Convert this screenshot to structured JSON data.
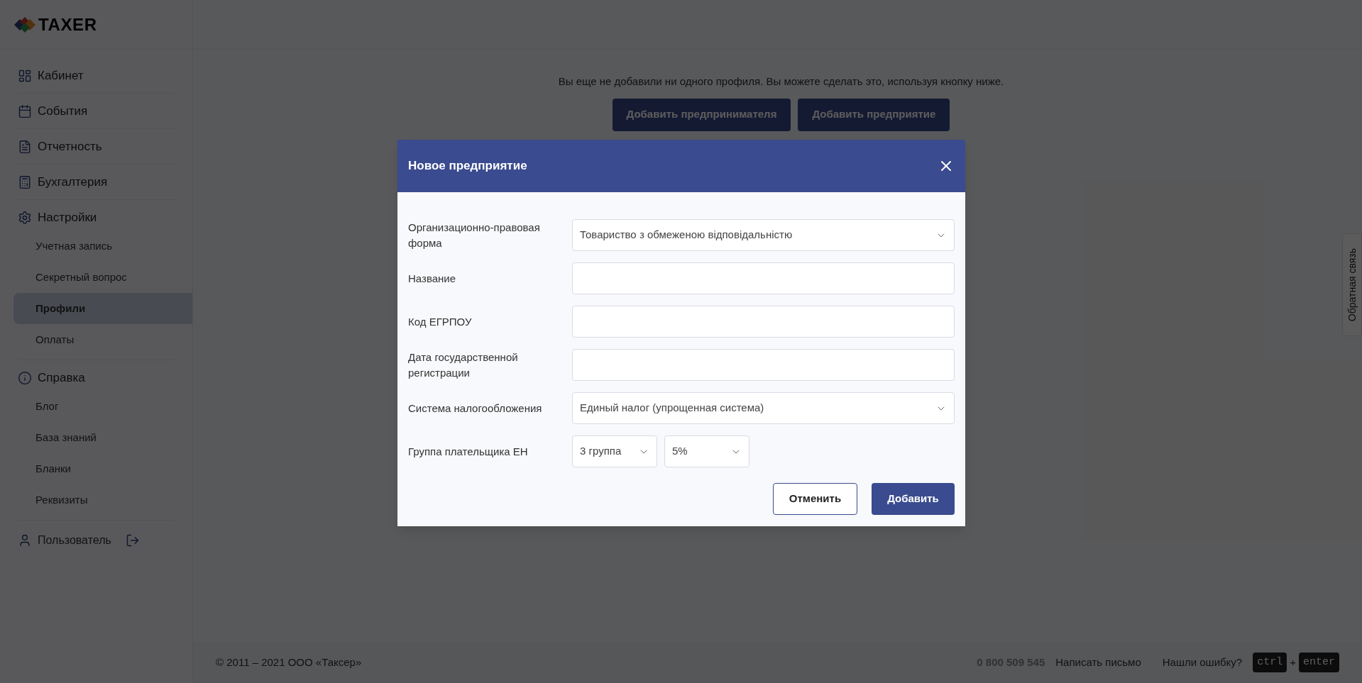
{
  "logo": {
    "text": "TAXER"
  },
  "sidebar": {
    "sections": [
      {
        "label": "Кабинет"
      },
      {
        "label": "События"
      },
      {
        "label": "Отчетность"
      },
      {
        "label": "Бухгалтерия"
      },
      {
        "label": "Настройки",
        "children": [
          {
            "label": "Учетная запись",
            "selected": false
          },
          {
            "label": "Секретный вопрос",
            "selected": false
          },
          {
            "label": "Профили",
            "selected": true
          },
          {
            "label": "Оплаты",
            "selected": false
          }
        ]
      },
      {
        "label": "Справка",
        "children": [
          {
            "label": "Блог",
            "selected": false
          },
          {
            "label": "База знаний",
            "selected": false
          },
          {
            "label": "Бланки",
            "selected": false
          },
          {
            "label": "Реквизиты",
            "selected": false
          }
        ]
      }
    ],
    "user": {
      "label": "Пользователь"
    }
  },
  "main": {
    "message": "Вы еще не добавили ни одного профиля. Вы можете сделать это, используя кнопку ниже.",
    "buttons": [
      "Добавить предпринимателя",
      "Добавить предприятие"
    ]
  },
  "dialog": {
    "title": "Новое предприятие",
    "fields": [
      {
        "kind": "select",
        "label": "Организационно-правовая форма",
        "value": "Товариство з обмеженою відповідальністю"
      },
      {
        "kind": "input",
        "label": "Название"
      },
      {
        "kind": "input",
        "label": "Код ЕГРПОУ"
      },
      {
        "kind": "input",
        "label": "Дата государственной регистрации"
      },
      {
        "kind": "select",
        "label": "Система налогообложения",
        "value": "Единый налог (упрощенная система)"
      },
      {
        "kind": "pair",
        "label": "Группа плательщика ЕН",
        "values": [
          "3 группа",
          "5%"
        ]
      }
    ],
    "cancel": "Отменить",
    "submit": "Добавить"
  },
  "feedback_tab": "Обратная связь",
  "footer": {
    "copyright": "© 2011 – 2021 ООО «Таксер»",
    "phone": "0 800 509 545",
    "write": "Написать письмо",
    "error_hint": "Нашли ошибку?",
    "keys": [
      "ctrl",
      "enter"
    ],
    "plus": "+"
  }
}
